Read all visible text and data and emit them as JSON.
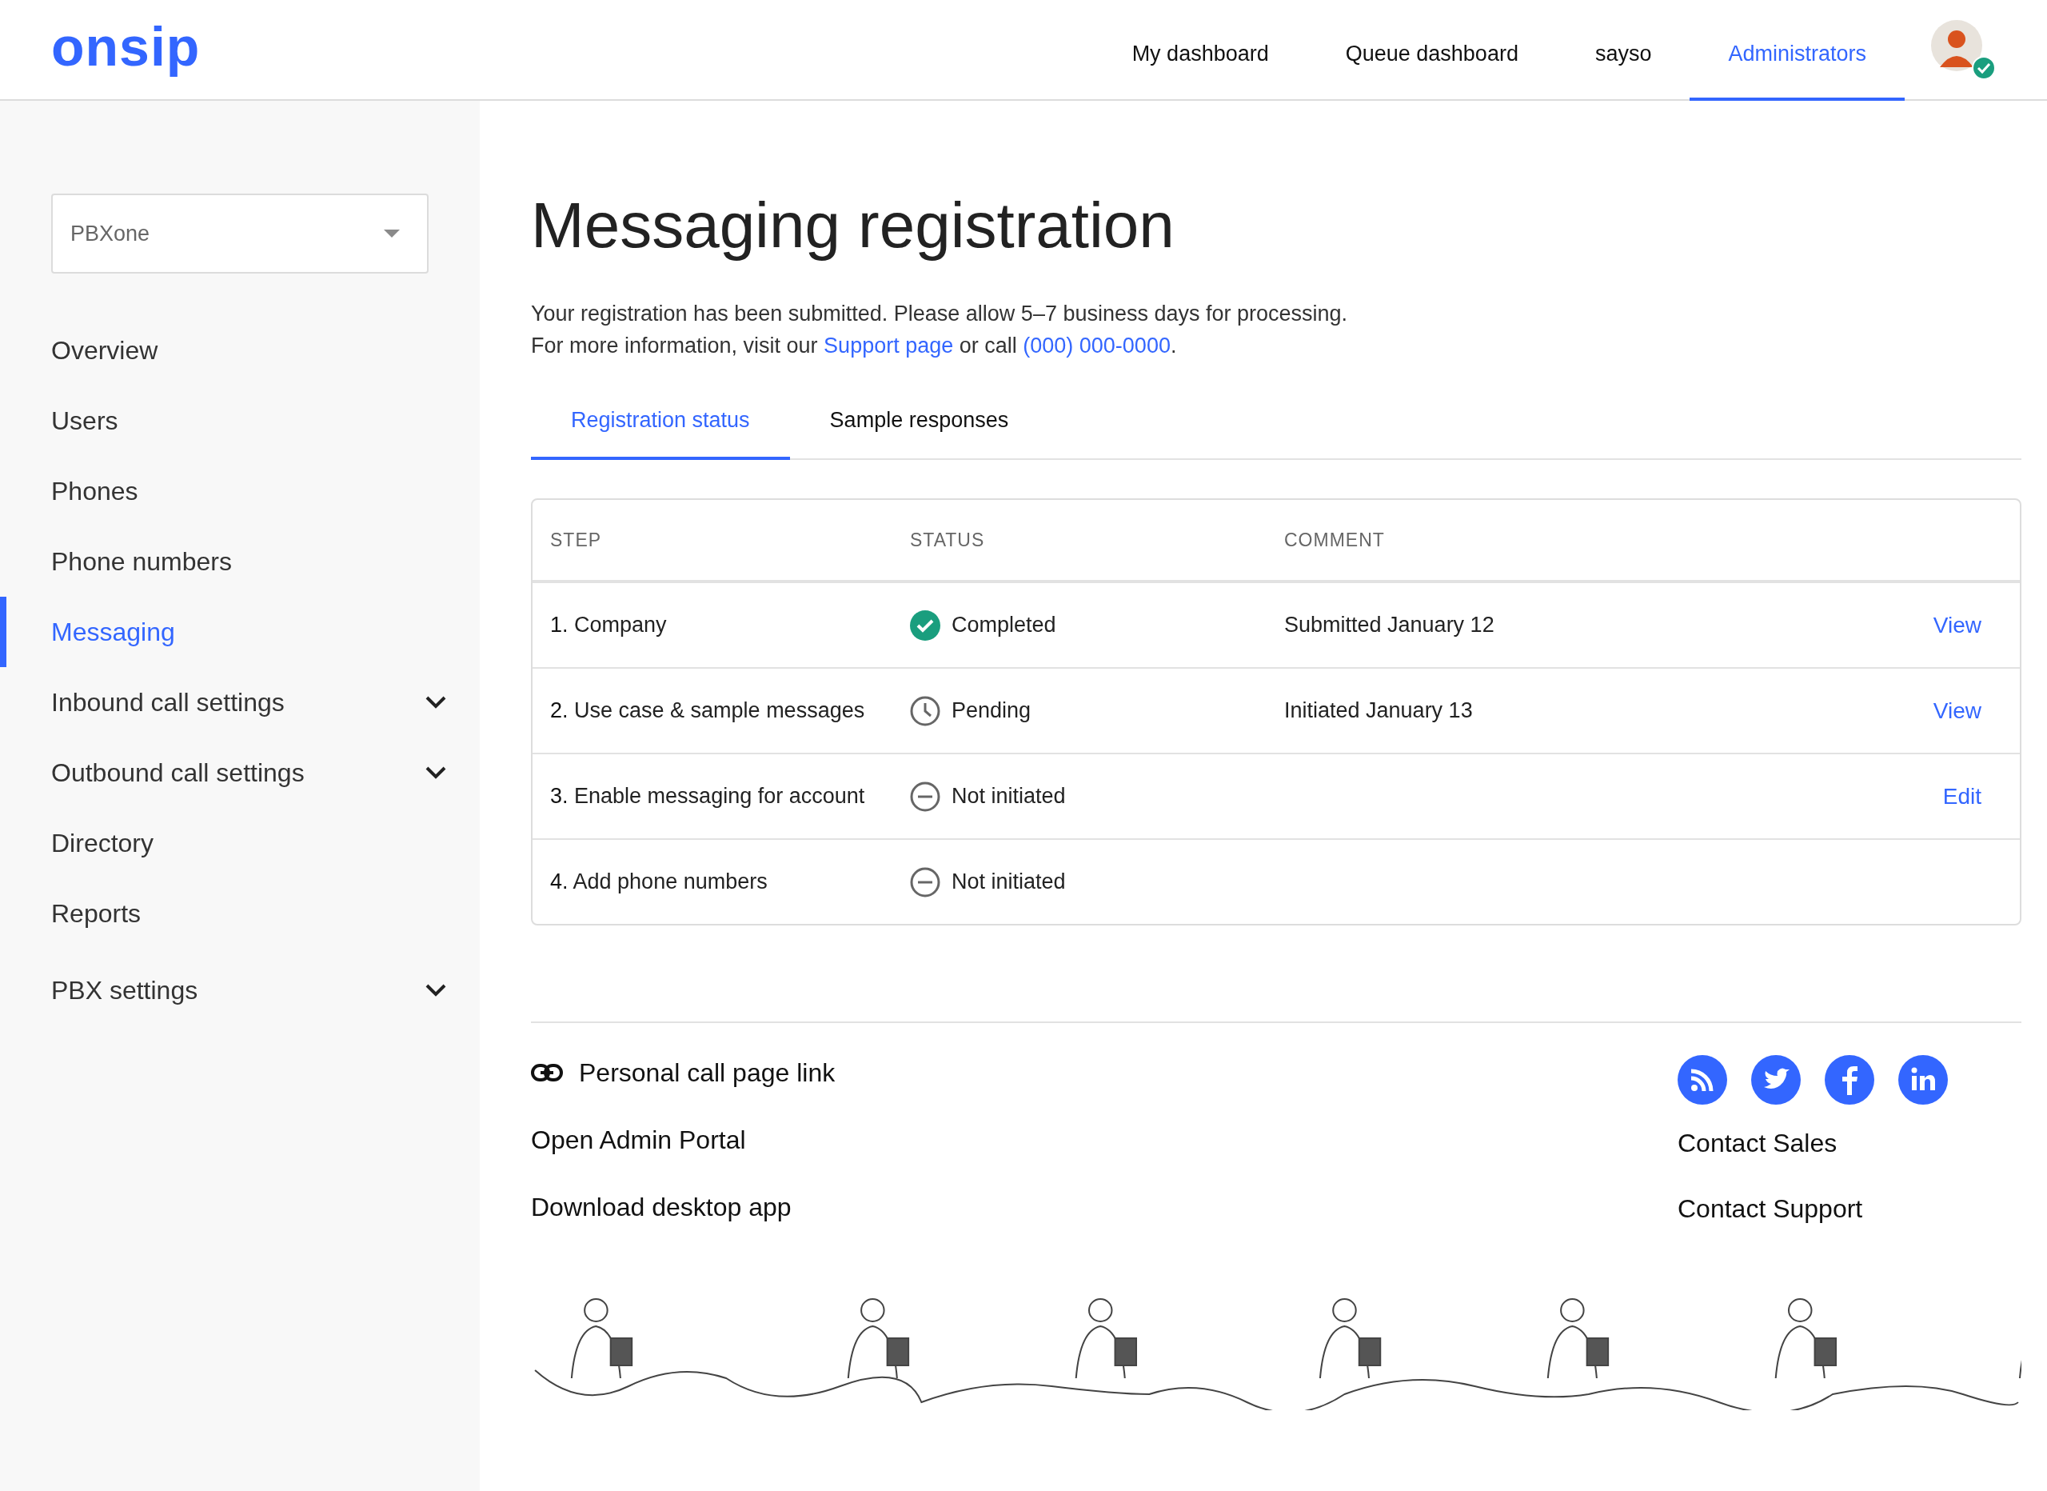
{
  "header": {
    "logo": "onsip",
    "nav": [
      {
        "label": "My dashboard",
        "selected": false
      },
      {
        "label": "Queue dashboard",
        "selected": false
      },
      {
        "label": "sayso",
        "selected": false
      },
      {
        "label": "Administrators",
        "selected": true
      }
    ],
    "avatar": {
      "verified": true
    }
  },
  "sidebar": {
    "account_select": {
      "value": "PBXone"
    },
    "items": [
      {
        "label": "Overview",
        "selected": false,
        "expandable": false
      },
      {
        "label": "Users",
        "selected": false,
        "expandable": false
      },
      {
        "label": "Phones",
        "selected": false,
        "expandable": false
      },
      {
        "label": "Phone numbers",
        "selected": false,
        "expandable": false
      },
      {
        "label": "Messaging",
        "selected": true,
        "expandable": false
      },
      {
        "label": "Inbound call settings",
        "selected": false,
        "expandable": true
      },
      {
        "label": "Outbound call settings",
        "selected": false,
        "expandable": true
      },
      {
        "label": "Directory",
        "selected": false,
        "expandable": false
      },
      {
        "label": "Reports",
        "selected": false,
        "expandable": false
      },
      {
        "label": "PBX settings",
        "selected": false,
        "expandable": true
      }
    ]
  },
  "main": {
    "title": "Messaging registration",
    "intro": "Your registration has been submitted. Please allow 5–7 business days for processing.",
    "info": {
      "before": "For more information, visit our",
      "link": "Support page",
      "middle": "or call",
      "phone": "(000) 000-0000",
      "after": "."
    },
    "tabs": [
      {
        "label": "Registration status",
        "selected": true
      },
      {
        "label": "Sample responses",
        "selected": false
      }
    ],
    "table": {
      "columns": [
        "STEP",
        "STATUS",
        "COMMENT"
      ],
      "rows": [
        {
          "number": "1.",
          "step": "Company",
          "status": {
            "kind": "completed",
            "label": "Completed"
          },
          "comment": "Submitted January 12",
          "action": "View"
        },
        {
          "number": "2.",
          "step": "Use case & sample messages",
          "status": {
            "kind": "pending",
            "label": "Pending"
          },
          "comment": "Initiated January 13",
          "action": "View"
        },
        {
          "number": "3.",
          "step": "Enable messaging for account",
          "status": {
            "kind": "not_initiated",
            "label": "Not initiated"
          },
          "action": "Edit"
        },
        {
          "number": "4.",
          "step": "Add phone numbers",
          "status": {
            "kind": "not_initiated",
            "label": "Not initiated"
          }
        }
      ]
    }
  },
  "footer": {
    "links_left": [
      {
        "label": "Personal call page link",
        "kind": "link-icon"
      },
      {
        "label": "Open Admin Portal",
        "kind": "plain"
      },
      {
        "label": "Download desktop app",
        "kind": "plain"
      }
    ],
    "social": [
      {
        "kind": "rss"
      },
      {
        "kind": "twitter"
      },
      {
        "kind": "facebook"
      },
      {
        "kind": "linkedin"
      }
    ],
    "links_right": [
      "Contact Sales",
      "Contact Support"
    ]
  }
}
